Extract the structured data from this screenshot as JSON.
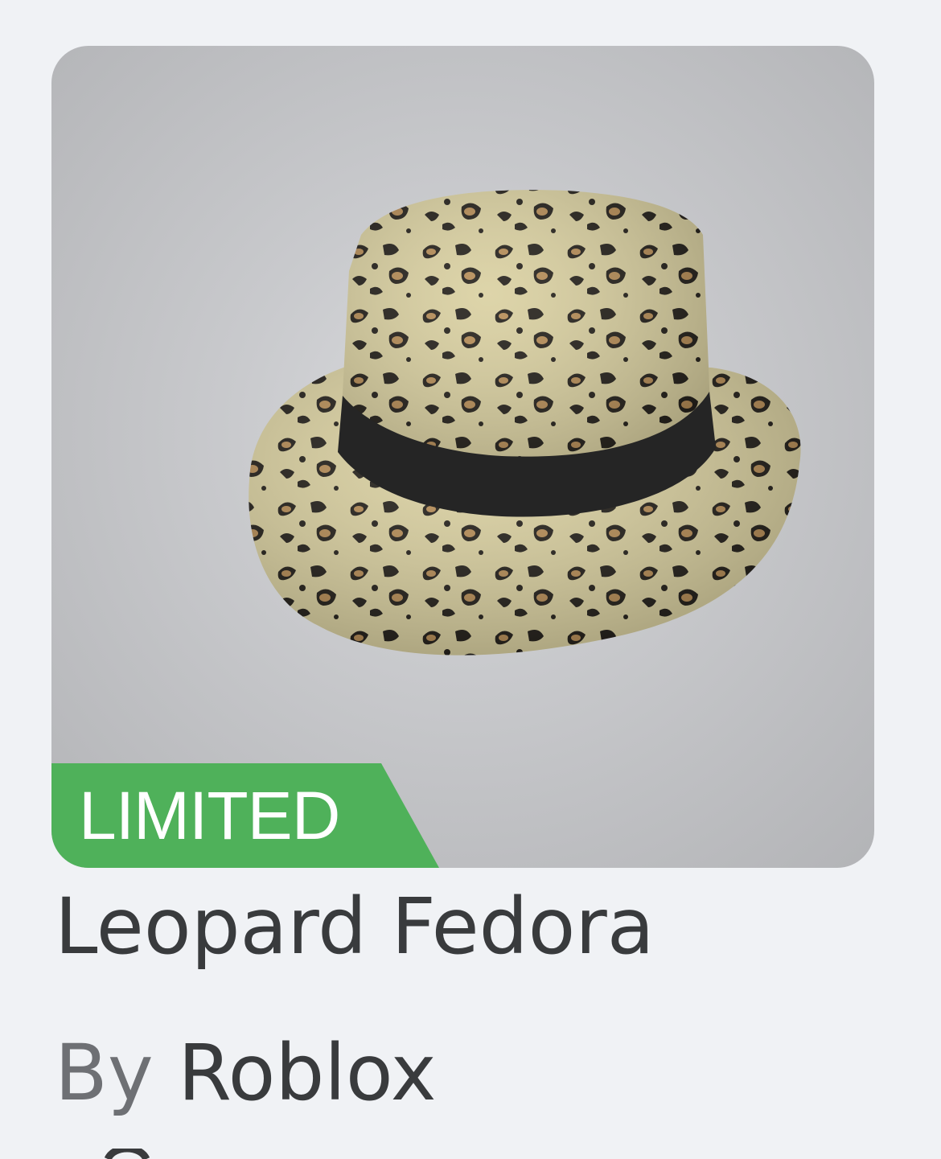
{
  "item": {
    "badge": "LIMITED",
    "name": "Leopard Fedora",
    "creator_prefix": "By",
    "creator_name": "Roblox",
    "thumbnail_icon": "leopard-fedora-hat"
  },
  "colors": {
    "page_background": "#f0f2f5",
    "thumbnail_background": "#c9cacd",
    "badge_green": "#4fb15a",
    "title_text": "#393b3d",
    "secondary_text": "#6e7074"
  }
}
